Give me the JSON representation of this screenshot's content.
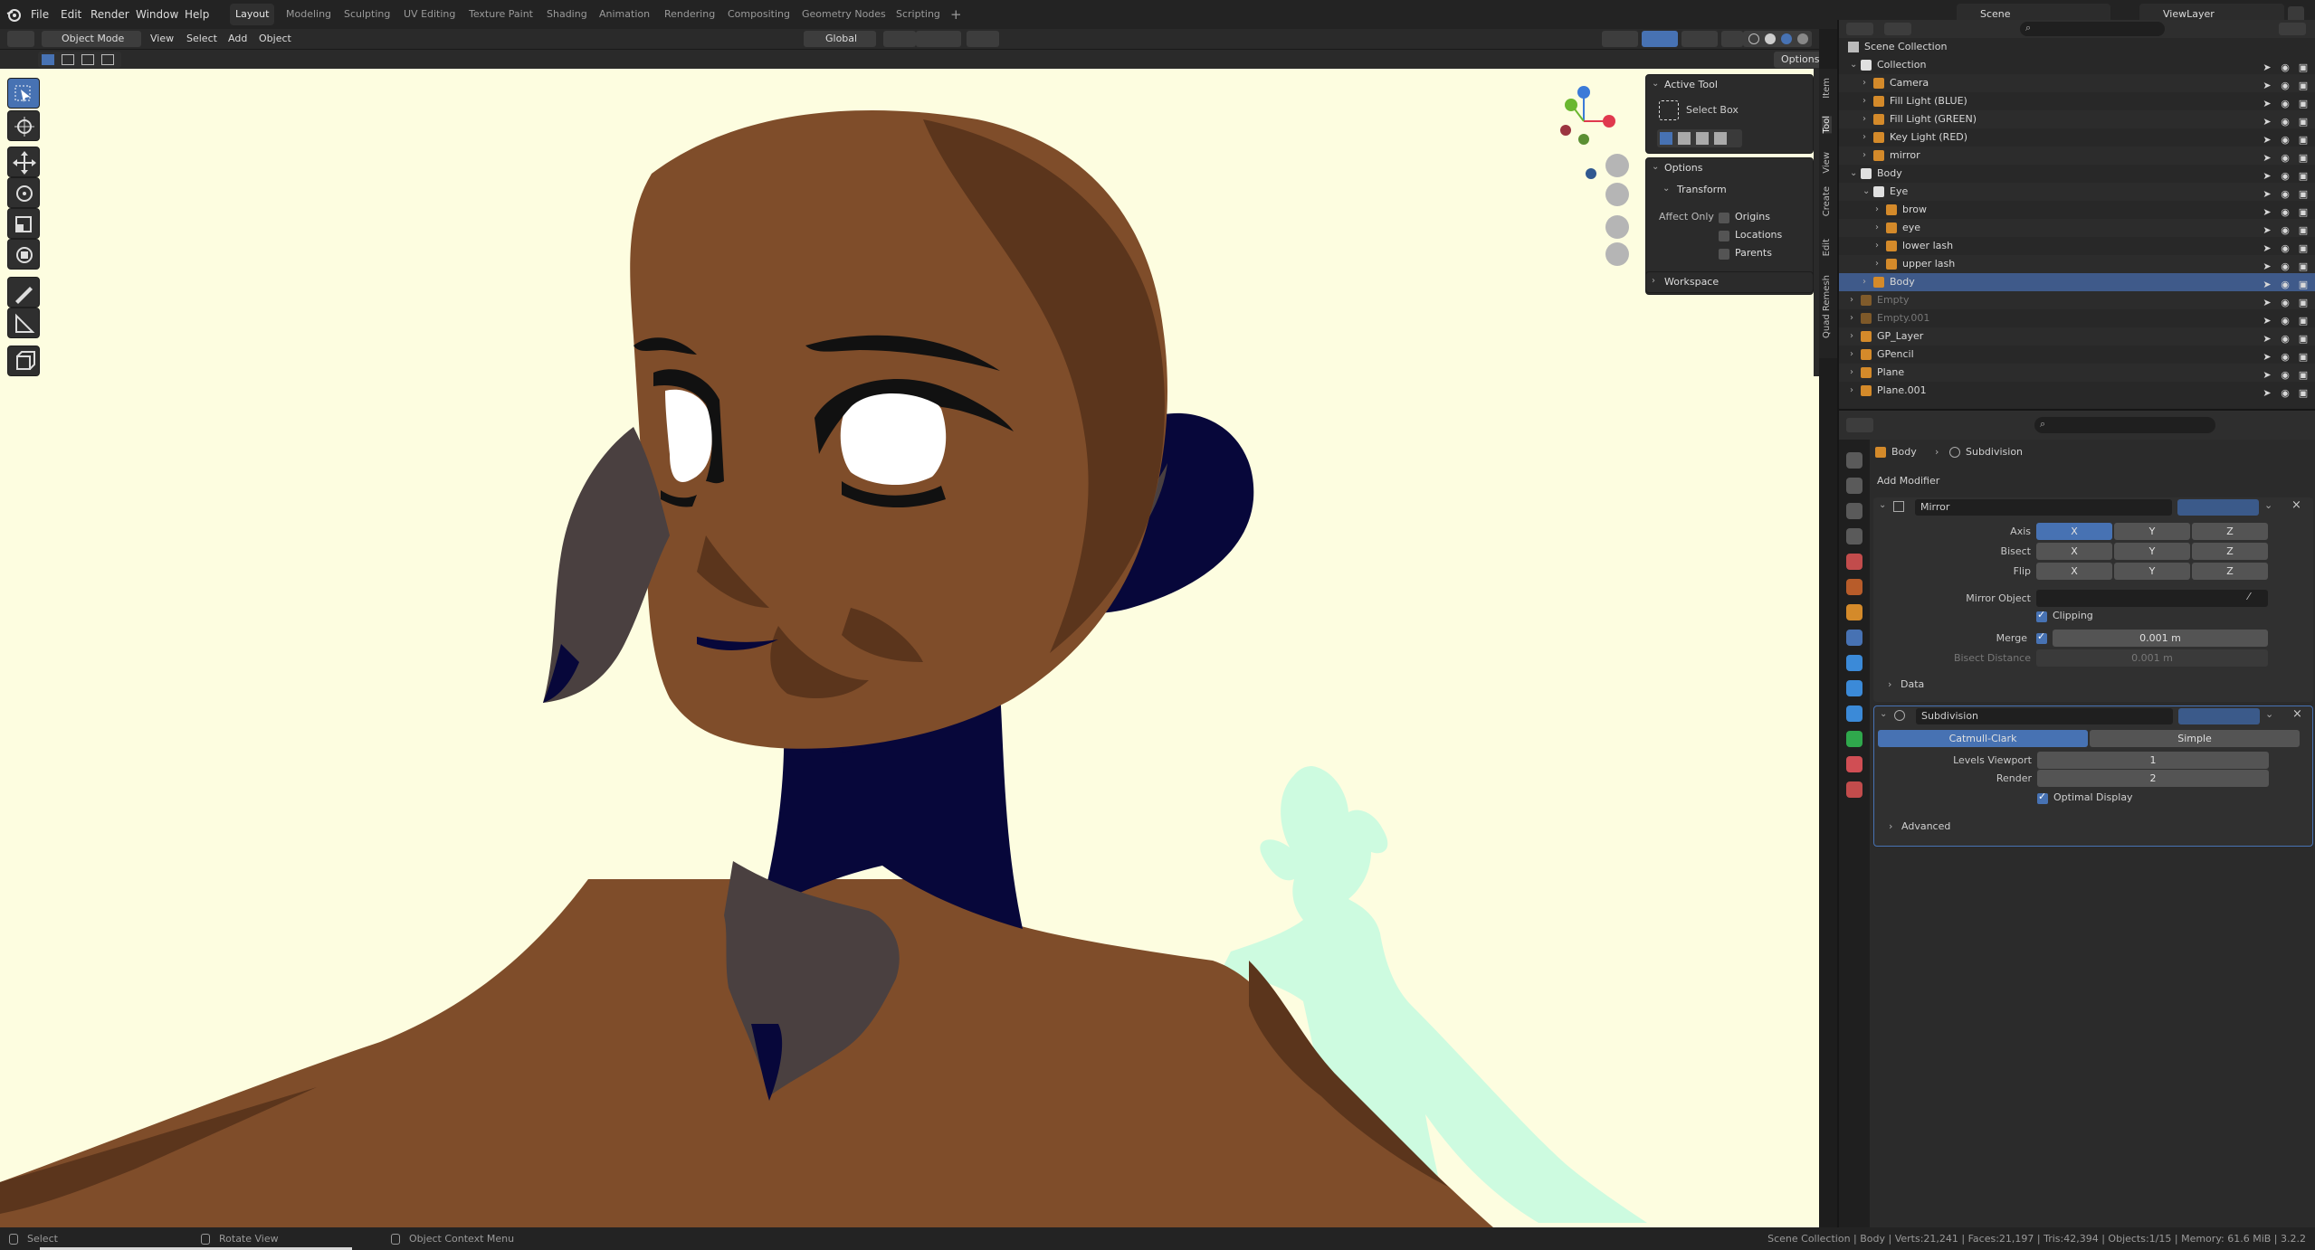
{
  "menu": [
    "File",
    "Edit",
    "Render",
    "Window",
    "Help"
  ],
  "workspaces": [
    "Layout",
    "Modeling",
    "Sculpting",
    "UV Editing",
    "Texture Paint",
    "Shading",
    "Animation",
    "Rendering",
    "Compositing",
    "Geometry Nodes",
    "Scripting"
  ],
  "active_workspace": "Layout",
  "scene_name": "Scene",
  "view_layer": "ViewLayer",
  "viewport_header": {
    "mode": "Object Mode",
    "menus": [
      "View",
      "Select",
      "Add",
      "Object"
    ],
    "transform_orientation": "Global",
    "options_label": "Options"
  },
  "tool_panel": {
    "active_tool_title": "Active Tool",
    "tool_name": "Select Box",
    "options_title": "Options",
    "transform_title": "Transform",
    "affect_only_label": "Affect Only",
    "affect_only_items": [
      "Origins",
      "Locations",
      "Parents"
    ],
    "workspace_title": "Workspace"
  },
  "side_tabs": [
    "Item",
    "Tool",
    "View",
    "Create",
    "Edit",
    "Quad Remesh"
  ],
  "outliner": {
    "title": "Scene Collection",
    "rows": [
      {
        "label": "Collection",
        "indent": 1,
        "type": "collection"
      },
      {
        "label": "Camera",
        "indent": 2,
        "type": "camera"
      },
      {
        "label": "Fill Light (BLUE)",
        "indent": 2,
        "type": "light"
      },
      {
        "label": "Fill Light (GREEN)",
        "indent": 2,
        "type": "light"
      },
      {
        "label": "Key Light (RED)",
        "indent": 2,
        "type": "light"
      },
      {
        "label": "mirror",
        "indent": 2,
        "type": "empty"
      },
      {
        "label": "Body",
        "indent": 1,
        "type": "collection"
      },
      {
        "label": "Eye",
        "indent": 2,
        "type": "collection"
      },
      {
        "label": "brow",
        "indent": 3,
        "type": "mesh"
      },
      {
        "label": "eye",
        "indent": 3,
        "type": "mesh"
      },
      {
        "label": "lower lash",
        "indent": 3,
        "type": "mesh"
      },
      {
        "label": "upper lash",
        "indent": 3,
        "type": "mesh"
      },
      {
        "label": "Body",
        "indent": 2,
        "type": "mesh",
        "selected": true
      },
      {
        "label": "Empty",
        "indent": 1,
        "type": "empty",
        "dim": true
      },
      {
        "label": "Empty.001",
        "indent": 1,
        "type": "empty",
        "dim": true
      },
      {
        "label": "GP_Layer",
        "indent": 1,
        "type": "mesh"
      },
      {
        "label": "GPencil",
        "indent": 1,
        "type": "mesh"
      },
      {
        "label": "Plane",
        "indent": 1,
        "type": "mesh"
      },
      {
        "label": "Plane.001",
        "indent": 1,
        "type": "mesh"
      }
    ]
  },
  "properties": {
    "breadcrumb_object": "Body",
    "breadcrumb_modifier": "Subdivision",
    "add_modifier": "Add Modifier",
    "mirror": {
      "name": "Mirror",
      "axis_label": "Axis",
      "bisect_label": "Bisect",
      "flip_label": "Flip",
      "axes": [
        "X",
        "Y",
        "Z"
      ],
      "mirror_object_label": "Mirror Object",
      "clipping_label": "Clipping",
      "merge_label": "Merge",
      "merge_value": "0.001 m",
      "bisect_distance_label": "Bisect Distance",
      "bisect_distance_value": "0.001 m",
      "data_label": "Data"
    },
    "subdivision": {
      "name": "Subdivision",
      "catmull": "Catmull-Clark",
      "simple": "Simple",
      "levels_viewport_label": "Levels Viewport",
      "levels_viewport": "1",
      "render_label": "Render",
      "render_value": "2",
      "optimal_display": "Optimal Display",
      "advanced": "Advanced"
    }
  },
  "status": {
    "select": "Select",
    "rotate": "Rotate View",
    "context": "Object Context Menu",
    "stats": "Scene Collection | Body | Verts:21,241 | Faces:21,197 | Tris:42,394 | Objects:1/15 | Memory: 61.6 MiB | 3.2.2"
  },
  "colors": {
    "viewport_bg": "#fdfde0",
    "skin": "#7f4d2a",
    "skin_shadow": "#5b351c",
    "dark_blue": "#07073a",
    "gray_hair": "#4a4040",
    "mint_silhouette": "#cdfbe0",
    "accent": "#4772b3"
  }
}
